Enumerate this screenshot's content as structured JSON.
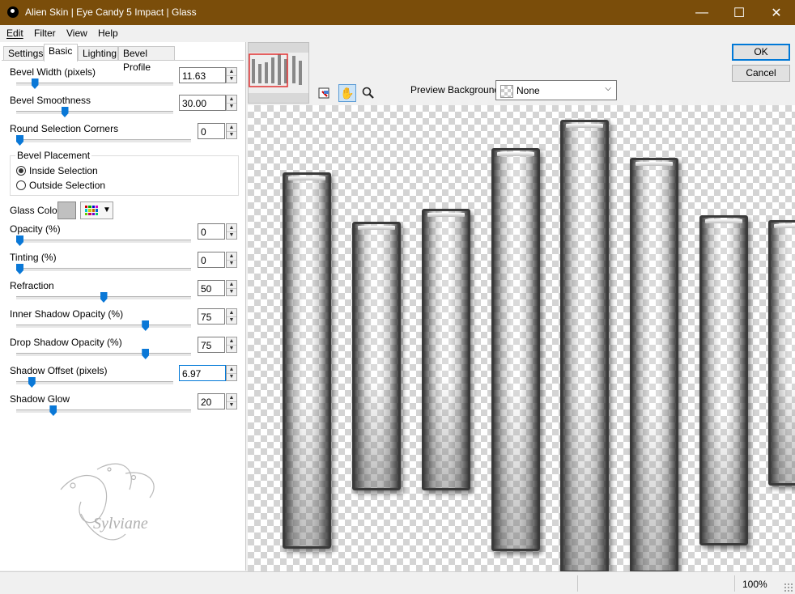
{
  "window": {
    "title": "Alien Skin | Eye Candy 5 Impact | Glass",
    "minimize": "—",
    "maximize": "☐",
    "close": "✕",
    "accent": "#7a4d0a"
  },
  "menu": [
    "Edit",
    "Filter",
    "View",
    "Help"
  ],
  "tabs": [
    "Settings",
    "Basic",
    "Lighting",
    "Bevel Profile"
  ],
  "active_tab": "Basic",
  "controls": {
    "bevel_width": {
      "label": "Bevel Width (pixels)",
      "value": "11.63",
      "slider": 0.1
    },
    "bevel_smoothness": {
      "label": "Bevel Smoothness",
      "value": "30.00",
      "slider": 0.3
    },
    "round_corners": {
      "label": "Round Selection Corners",
      "value": "0",
      "slider": 0.0
    },
    "opacity": {
      "label": "Opacity (%)",
      "value": "0",
      "slider": 0.0
    },
    "tinting": {
      "label": "Tinting (%)",
      "value": "0",
      "slider": 0.0
    },
    "refraction": {
      "label": "Refraction",
      "value": "50",
      "slider": 0.5
    },
    "inner_shadow": {
      "label": "Inner Shadow Opacity (%)",
      "value": "75",
      "slider": 0.75
    },
    "drop_shadow": {
      "label": "Drop Shadow Opacity (%)",
      "value": "75",
      "slider": 0.75
    },
    "shadow_offset": {
      "label": "Shadow Offset (pixels)",
      "value": "6.97",
      "slider": 0.08
    },
    "shadow_glow": {
      "label": "Shadow Glow",
      "value": "20",
      "slider": 0.2
    }
  },
  "bevel_placement": {
    "title": "Bevel Placement",
    "options": [
      "Inside Selection",
      "Outside Selection"
    ],
    "selected": "Inside Selection"
  },
  "glass_color": {
    "label": "Glass Color",
    "color": "#c0c0c0"
  },
  "preview_background": {
    "label": "Preview Background:",
    "value": "None"
  },
  "buttons": {
    "ok": "OK",
    "cancel": "Cancel"
  },
  "tool_icons": [
    "navigate-icon",
    "hand-icon",
    "zoom-icon"
  ],
  "watermark_text": "Sylviane",
  "status": {
    "zoom": "100%"
  }
}
